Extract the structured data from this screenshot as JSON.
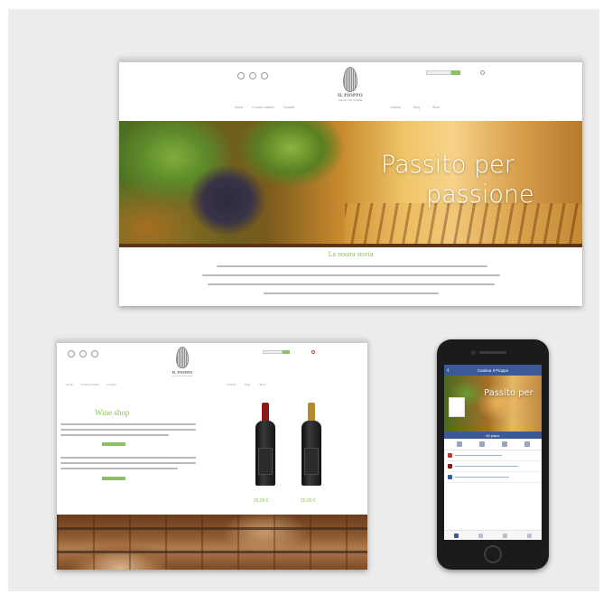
{
  "desktop": {
    "brand": "IL PIOPPO",
    "tagline": "vini dei colli vicentini",
    "nav_left": [
      "Home",
      "Il nostro passito",
      "Contatti"
    ],
    "nav_right": [
      "Cantina",
      "Blog",
      "Shop"
    ],
    "hero_line1": "Passito per",
    "hero_line2": "passione",
    "story_title": "La nostra storia"
  },
  "shop": {
    "brand": "IL PIOPPO",
    "tagline": "vini dei colli vicentini",
    "nav_left": [
      "Home",
      "Il nostro passito",
      "Contatti"
    ],
    "nav_right": [
      "Cantina",
      "Blog",
      "Shop"
    ],
    "title": "Wine shop",
    "bottles": [
      {
        "price": "25,00 €",
        "neck_color": "#8b1a1a"
      },
      {
        "price": "20,00 €",
        "neck_color": "#b08a2c"
      }
    ]
  },
  "phone": {
    "header": "Cantina Il Pioppo",
    "cover_text": "Passito per",
    "like_label": "Mi piace"
  },
  "colors": {
    "accent_green": "#8cbf55",
    "facebook_blue": "#3b5998",
    "wine_band": "#5b3316"
  }
}
